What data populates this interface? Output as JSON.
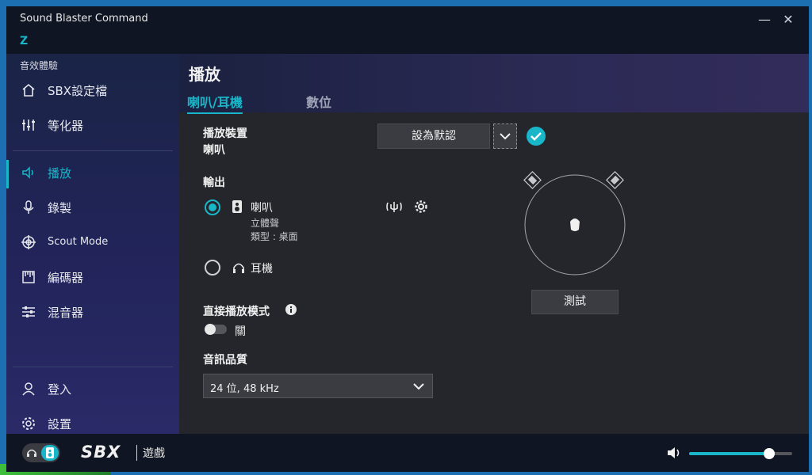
{
  "app": {
    "title": "Sound Blaster Command",
    "logo_text": "Z"
  },
  "window_controls": {
    "minimize": "—",
    "close": "✕"
  },
  "sidebar": {
    "section_label": "音效體驗",
    "items": [
      {
        "label": "SBX設定檔",
        "icon": "home-icon"
      },
      {
        "label": "等化器",
        "icon": "equalizer-icon"
      },
      {
        "label": "播放",
        "icon": "speaker-icon",
        "active": true
      },
      {
        "label": "錄製",
        "icon": "microphone-icon"
      },
      {
        "label": "Scout Mode",
        "icon": "crosshair-icon"
      },
      {
        "label": "編碼器",
        "icon": "encoder-icon"
      },
      {
        "label": "混音器",
        "icon": "mixer-icon"
      }
    ],
    "bottom_items": [
      {
        "label": "登入",
        "icon": "user-icon"
      },
      {
        "label": "設置",
        "icon": "gear-icon"
      }
    ]
  },
  "main": {
    "page_title": "播放",
    "tabs": [
      {
        "label": "喇叭/耳機",
        "active": true
      },
      {
        "label": "數位"
      }
    ],
    "playback_device": {
      "heading": "播放裝置",
      "value": "喇叭",
      "default_button": "設為默認"
    },
    "output": {
      "heading": "輸出",
      "options": [
        {
          "label": "喇叭",
          "selected": true,
          "details": [
            "立體聲",
            "類型 : 桌面"
          ]
        },
        {
          "label": "耳機",
          "selected": false
        }
      ]
    },
    "direct_mode": {
      "heading": "直接播放模式",
      "state_label": "關",
      "enabled": false
    },
    "audio_quality": {
      "heading": "音訊品質",
      "value": "24 位, 48 kHz"
    },
    "test_button": "測試"
  },
  "footer": {
    "sbx_logo": "SBX",
    "mode_label": "遊戲",
    "volume_fraction": 0.78
  },
  "colors": {
    "accent": "#19b6c9"
  }
}
